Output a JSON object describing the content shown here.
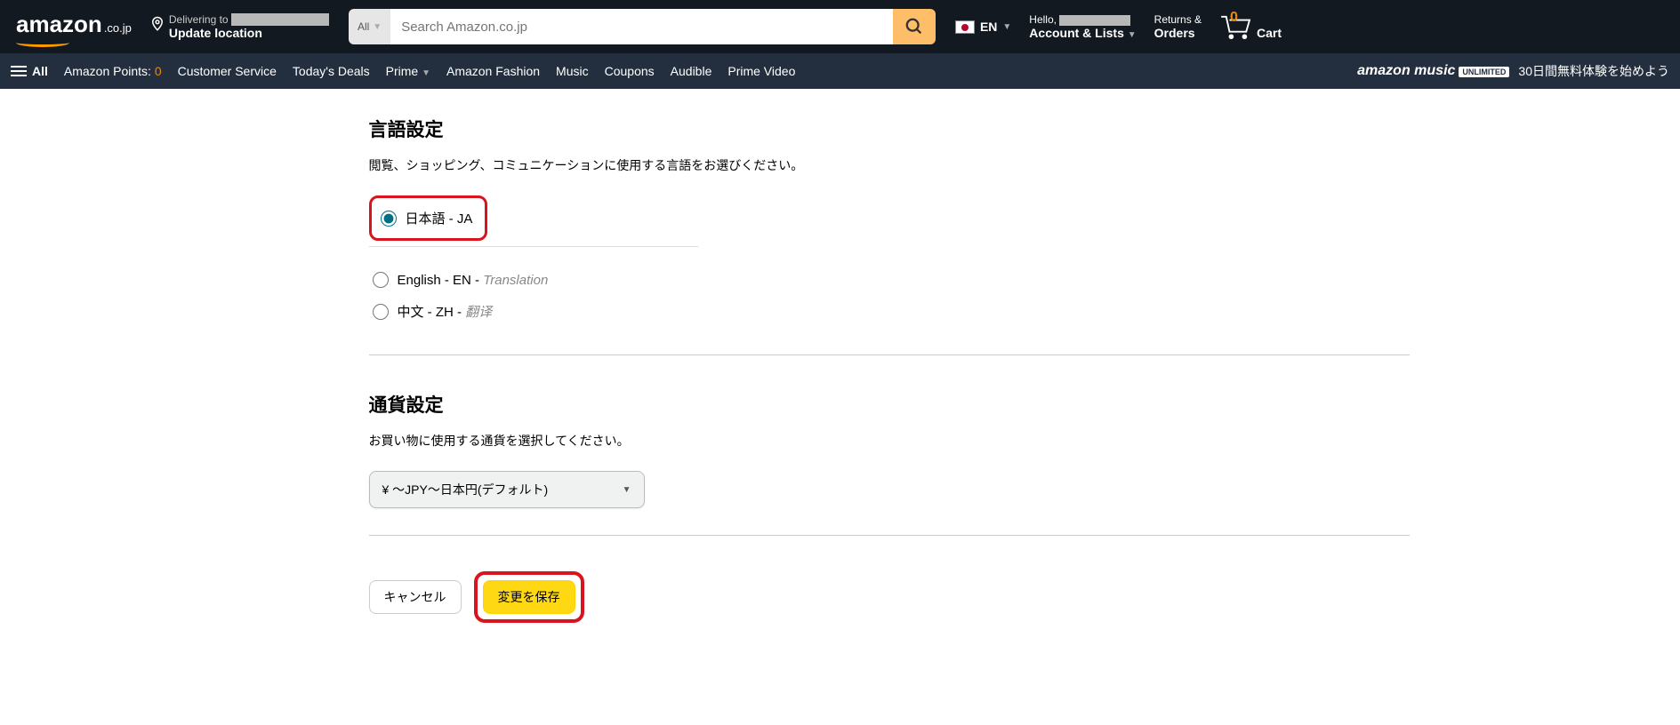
{
  "header": {
    "logo_text": "amazon",
    "logo_domain": ".co.jp",
    "delivering_to": "Delivering to",
    "update_location": "Update location",
    "search_category": "All",
    "search_placeholder": "Search Amazon.co.jp",
    "lang_label": "EN",
    "hello": "Hello,",
    "account_lists": "Account & Lists",
    "returns": "Returns &",
    "orders": "Orders",
    "cart_count": "0",
    "cart_label": "Cart"
  },
  "subnav": {
    "all": "All",
    "points_label": "Amazon Points:",
    "points_count": "0",
    "items": [
      "Customer Service",
      "Today's Deals",
      "Prime",
      "Amazon Fashion",
      "Music",
      "Coupons",
      "Audible",
      "Prime Video"
    ],
    "music_logo": "amazon music",
    "music_unlimited": "UNLIMITED",
    "music_promo": "30日間無料体験を始めよう"
  },
  "language": {
    "heading": "言語設定",
    "desc": "閲覧、ショッピング、コミュニケーションに使用する言語をお選びください。",
    "options": [
      {
        "label": "日本語 - JA",
        "suffix": "",
        "checked": true
      },
      {
        "label": "English - EN - ",
        "suffix": "Translation",
        "checked": false
      },
      {
        "label": "中文 - ZH - ",
        "suffix": "翻译",
        "checked": false
      }
    ]
  },
  "currency": {
    "heading": "通貨設定",
    "desc": "お買い物に使用する通貨を選択してください。",
    "selected": "¥ ～JPY～日本円(デフォルト)"
  },
  "actions": {
    "cancel": "キャンセル",
    "save": "変更を保存"
  }
}
